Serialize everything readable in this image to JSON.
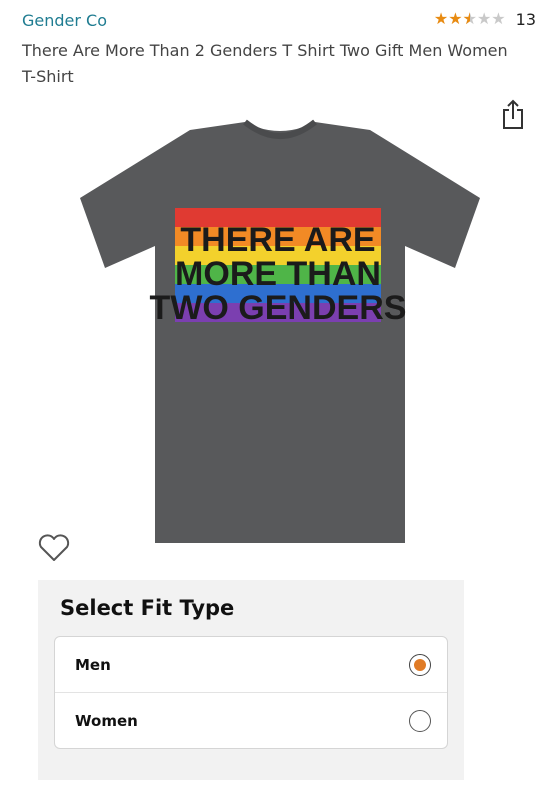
{
  "header": {
    "brand": "Gender Co",
    "rating": {
      "value": 2.5,
      "max": 5,
      "count": "13"
    },
    "title": "There Are More Than 2 Genders T Shirt Two Gift Men Women T-Shirt"
  },
  "product": {
    "shirt_color": "#58595b",
    "print_lines": [
      "THERE ARE",
      "MORE THAN",
      "TWO GENDERS"
    ],
    "rainbow": [
      "#e03a32",
      "#f28a25",
      "#f3d12c",
      "#4fb548",
      "#2e6fd0",
      "#7b3fb0"
    ]
  },
  "icons": {
    "share": "share-icon",
    "wishlist": "heart-icon"
  },
  "fit_type": {
    "heading": "Select Fit Type",
    "options": [
      {
        "label": "Men",
        "selected": true
      },
      {
        "label": "Women",
        "selected": false
      }
    ]
  },
  "colors": {
    "link": "#1f7c91",
    "star": "#e88b12",
    "radio_selected": "#e07b26"
  }
}
